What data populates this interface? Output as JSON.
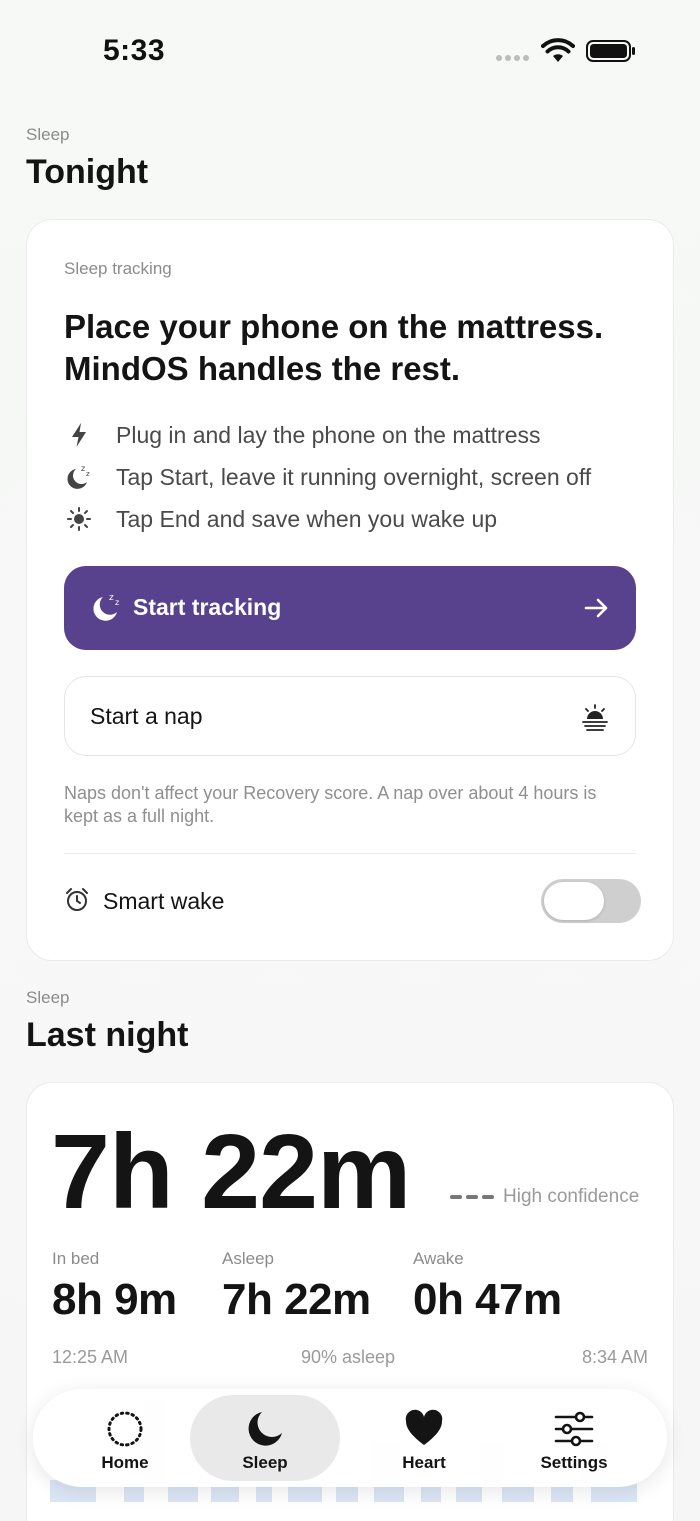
{
  "status_bar": {
    "time": "5:33"
  },
  "tonight": {
    "overline": "Sleep",
    "title": "Tonight",
    "card": {
      "overline": "Sleep tracking",
      "headline": "Place your phone on the mattress. MindOS handles the rest.",
      "steps": [
        {
          "icon": "bolt-icon",
          "text": "Plug in and lay the phone on the mattress"
        },
        {
          "icon": "moon-zzz-icon",
          "text": "Tap Start, leave it running overnight, screen off"
        },
        {
          "icon": "sun-icon",
          "text": "Tap End and save when you wake up"
        }
      ],
      "start_button": "Start tracking",
      "nap_button": "Start a nap",
      "nap_note": "Naps don't affect your Recovery score. A nap over about 4 hours is kept as a full night.",
      "smart_wake": {
        "label": "Smart wake",
        "enabled": false
      }
    },
    "accent_color": "#58418d"
  },
  "last_night": {
    "overline": "Sleep",
    "title": "Last night",
    "duration": "7h 22m",
    "confidence": "High confidence",
    "metrics": [
      {
        "label": "In bed",
        "value": "8h 9m"
      },
      {
        "label": "Asleep",
        "value": "7h 22m"
      },
      {
        "label": "Awake",
        "value": "0h 47m"
      }
    ],
    "start_time": "12:25 AM",
    "percent_asleep": "90% asleep",
    "end_time": "8:34 AM"
  },
  "tabbar": {
    "items": [
      {
        "label": "Home",
        "icon": "dotted-circle-icon",
        "active": false
      },
      {
        "label": "Sleep",
        "icon": "moon-icon",
        "active": true
      },
      {
        "label": "Heart",
        "icon": "heart-icon",
        "active": false
      },
      {
        "label": "Settings",
        "icon": "sliders-icon",
        "active": false
      }
    ]
  }
}
